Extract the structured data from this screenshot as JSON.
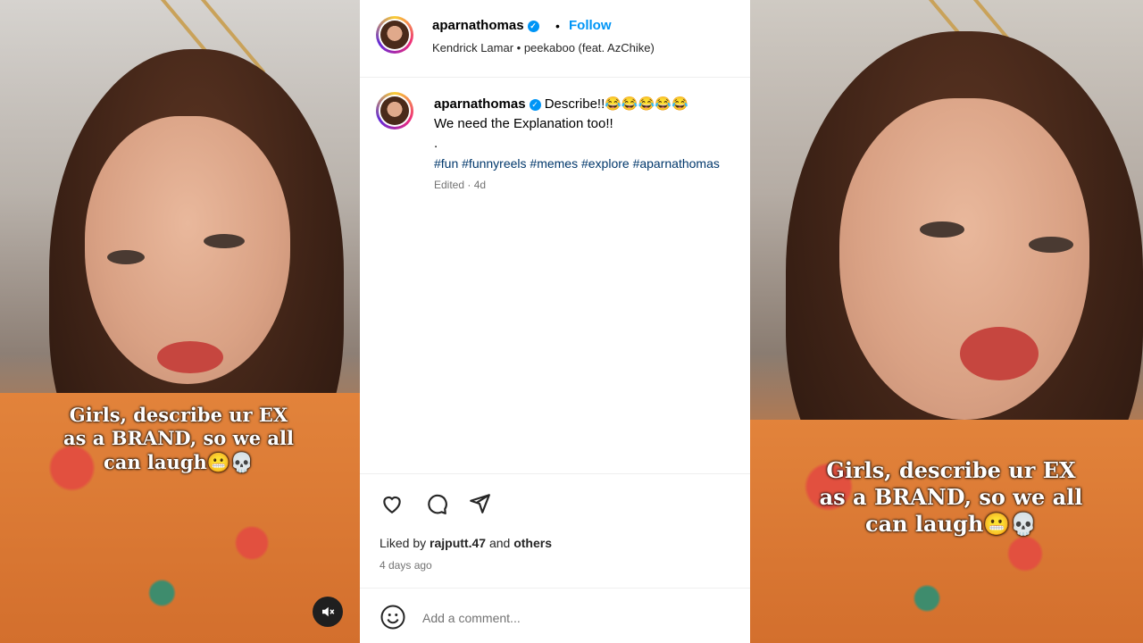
{
  "left_video": {
    "overlay_text": "Girls, describe ur EX as a BRAND, so we all can laugh😬💀",
    "mute_icon": "speaker-muted-icon"
  },
  "right_video": {
    "overlay_text": "Girls, describe ur EX as a BRAND, so we all can laugh😬💀"
  },
  "header": {
    "username": "aparnathomas",
    "separator": "•",
    "follow_label": "Follow",
    "audio": "Kendrick Lamar • peekaboo (feat. AzChike)"
  },
  "caption": {
    "username": "aparnathomas",
    "text": "Describe!!😂😂😂😂😂",
    "line2": "We need the Explanation too!!",
    "line3": ".",
    "hashtags": "#fun #funnyreels #memes #explore #aparnathomas",
    "meta": "Edited · 4d"
  },
  "actions": {
    "like_icon": "heart-icon",
    "comment_icon": "comment-icon",
    "share_icon": "send-icon"
  },
  "likes": {
    "prefix": "Liked by",
    "user": "rajputt.47",
    "and": "and",
    "others": "others"
  },
  "timestamp": "4 days ago",
  "comment": {
    "emoji_icon": "smiley-icon",
    "placeholder": "Add a comment..."
  },
  "colors": {
    "accent": "#0095f6",
    "hashtag": "#00376b",
    "muted": "#737373"
  }
}
